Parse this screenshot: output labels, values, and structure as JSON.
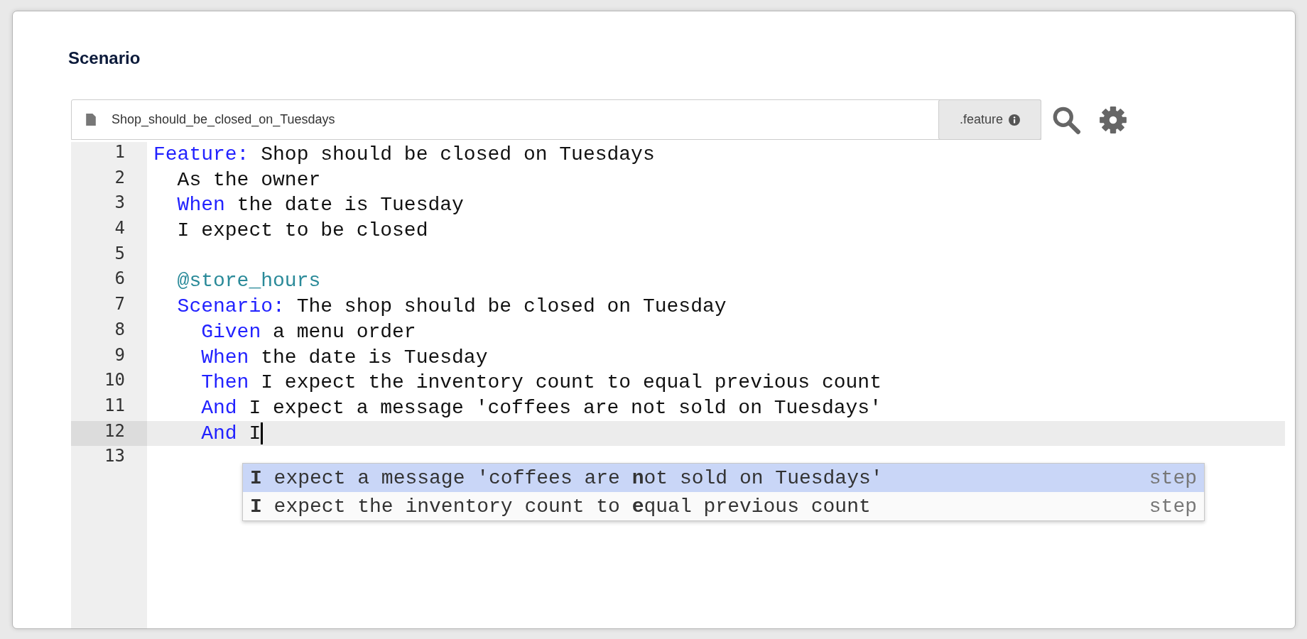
{
  "section": {
    "title": "Scenario"
  },
  "editor": {
    "filename": "Shop_should_be_closed_on_Tuesdays",
    "extension": ".feature",
    "lines": [
      {
        "number": "1",
        "active": false,
        "tokens": [
          {
            "kind": "keyword",
            "text": "Feature:"
          },
          {
            "kind": "text",
            "text": " Shop should be closed on Tuesdays"
          }
        ]
      },
      {
        "number": "2",
        "active": false,
        "tokens": [
          {
            "kind": "text",
            "text": "  As the owner"
          }
        ]
      },
      {
        "number": "3",
        "active": false,
        "tokens": [
          {
            "kind": "keyword",
            "text": "  When"
          },
          {
            "kind": "text",
            "text": " the date is Tuesday"
          }
        ]
      },
      {
        "number": "4",
        "active": false,
        "tokens": [
          {
            "kind": "text",
            "text": "  I expect to be closed"
          }
        ]
      },
      {
        "number": "5",
        "active": false
      },
      {
        "number": "6",
        "active": false,
        "tokens": [
          {
            "kind": "tag",
            "text": "  @store_hours"
          }
        ]
      },
      {
        "number": "7",
        "active": false,
        "tokens": [
          {
            "kind": "keyword",
            "text": "  Scenario:"
          },
          {
            "kind": "text",
            "text": " The shop should be closed on Tuesday"
          }
        ]
      },
      {
        "number": "8",
        "active": false,
        "tokens": [
          {
            "kind": "keyword",
            "text": "    Given"
          },
          {
            "kind": "text",
            "text": " a menu order"
          }
        ]
      },
      {
        "number": "9",
        "active": false,
        "tokens": [
          {
            "kind": "keyword",
            "text": "    When"
          },
          {
            "kind": "text",
            "text": " the date is Tuesday"
          }
        ]
      },
      {
        "number": "10",
        "active": false,
        "tokens": [
          {
            "kind": "keyword",
            "text": "    Then"
          },
          {
            "kind": "text",
            "text": " I expect the inventory count to equal previous count"
          }
        ]
      },
      {
        "number": "11",
        "active": false,
        "tokens": [
          {
            "kind": "keyword",
            "text": "    And"
          },
          {
            "kind": "text",
            "text": " I expect a message 'coffees are not sold on Tuesdays'"
          }
        ]
      },
      {
        "number": "12",
        "active": true,
        "tokens": [
          {
            "kind": "keyword",
            "text": "    And"
          },
          {
            "kind": "text",
            "text": " I"
          }
        ]
      },
      {
        "number": "13",
        "active": false
      }
    ],
    "autocomplete": [
      {
        "text": "**I** expect a message 'coffees are **n**ot sold on Tuesdays'",
        "type": "step",
        "selected": true
      },
      {
        "text": "**I** expect the inventory count to **e**qual previous count",
        "type": "step",
        "selected": false
      }
    ]
  }
}
